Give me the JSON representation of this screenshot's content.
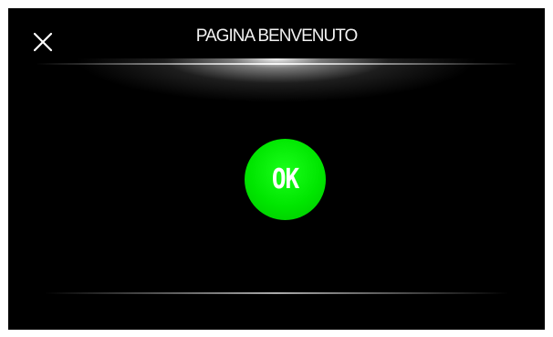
{
  "header": {
    "title": "PAGINA BENVENUTO",
    "close_icon": "close-icon"
  },
  "main": {
    "ok_label": "OK",
    "ok_color": "#00e600"
  },
  "colors": {
    "background": "#000000",
    "frame": "#ffffff",
    "text": "#f2f2f2",
    "accent": "#00e600"
  }
}
